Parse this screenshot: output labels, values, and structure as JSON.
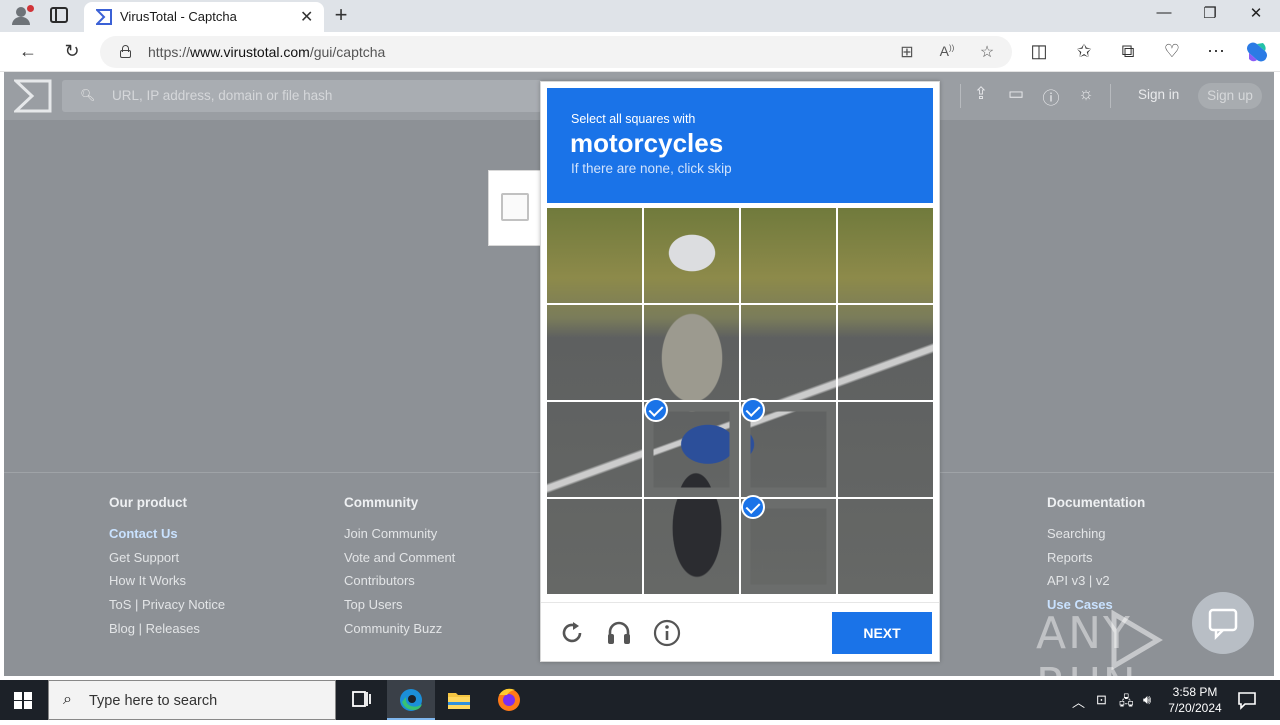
{
  "browser": {
    "tab_title": "VirusTotal - Captcha",
    "url_prefix": "https://",
    "url_domain": "www.virustotal.com",
    "url_path": "/gui/captcha",
    "window_controls": [
      "—",
      "❐",
      "✕"
    ]
  },
  "vt_header": {
    "search_placeholder": "URL, IP address, domain or file hash",
    "signin_label": "Sign in",
    "signup_label": "Sign up"
  },
  "footer": {
    "columns": [
      {
        "heading": "Our product",
        "links": [
          "Contact Us",
          "Get Support",
          "How It Works",
          "ToS | Privacy Notice",
          "Blog | Releases"
        ]
      },
      {
        "heading": "Community",
        "links": [
          "Join Community",
          "Vote and Comment",
          "Contributors",
          "Top Users",
          "Community Buzz"
        ]
      },
      {
        "heading": "Documentation",
        "links": [
          "Searching",
          "Reports",
          "API v3 | v2",
          "Use Cases"
        ]
      }
    ]
  },
  "challenge": {
    "instruction": "Select all squares with",
    "target": "motorcycles",
    "hint": "If there are none, click skip",
    "selected_cells": [
      9,
      10,
      14
    ],
    "next_label": "NEXT",
    "accent_color": "#1a73e8"
  },
  "watermark": "ANY RUN",
  "taskbar": {
    "search_placeholder": "Type here to search",
    "time": "3:58 PM",
    "date": "7/20/2024"
  }
}
